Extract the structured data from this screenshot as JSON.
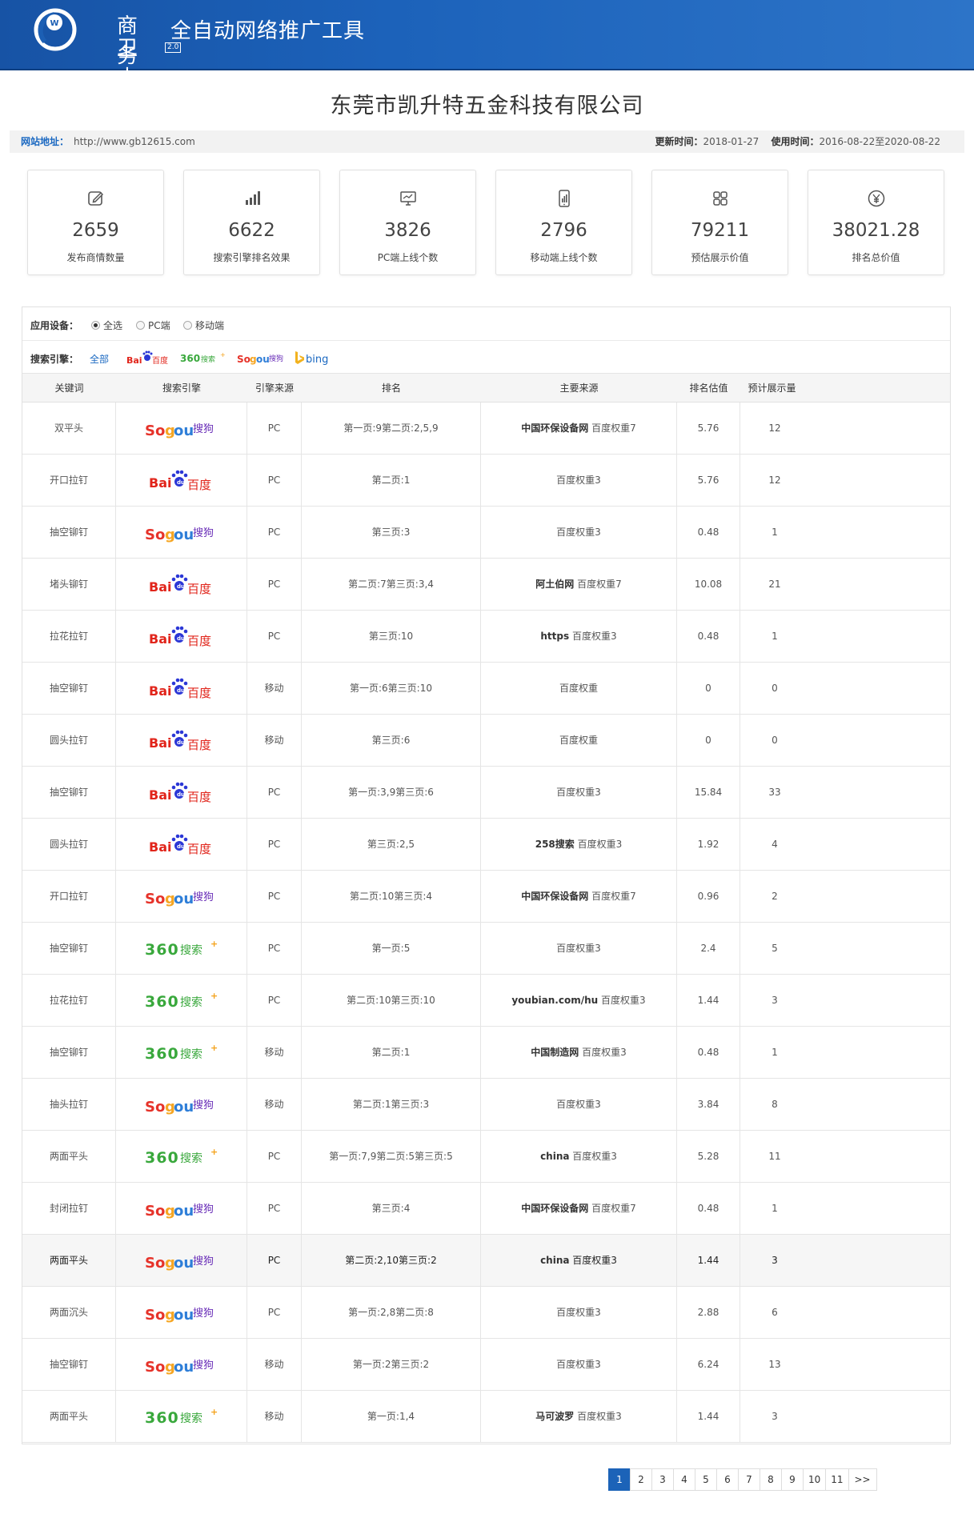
{
  "header": {
    "title": "全自动网络推广工具",
    "logo_line1": "商务",
    "logo_line2": "卫士",
    "logo_version": "2.0"
  },
  "company": "东莞市凯升特五金科技有限公司",
  "info": {
    "site_label": "网站地址：",
    "site_url": "http://www.gb12615.com",
    "update_label": "更新时间：",
    "update_value": "2018-01-27",
    "use_label": "使用时间：",
    "use_value": "2016-08-22至2020-08-22"
  },
  "stats": [
    {
      "icon": "edit-icon",
      "value": "2659",
      "label": "发布商情数量"
    },
    {
      "icon": "bar-chart-icon",
      "value": "6622",
      "label": "搜索引擎排名效果"
    },
    {
      "icon": "monitor-icon",
      "value": "3826",
      "label": "PC端上线个数"
    },
    {
      "icon": "mobile-icon",
      "value": "2796",
      "label": "移动端上线个数"
    },
    {
      "icon": "grid-icon",
      "value": "79211",
      "label": "预估展示价值"
    },
    {
      "icon": "yen-icon",
      "value": "38021.28",
      "label": "排名总价值"
    }
  ],
  "filters": {
    "device_label": "应用设备：",
    "device_options": [
      "全选",
      "PC端",
      "移动端"
    ],
    "device_selected": "全选",
    "engine_label": "搜索引擎：",
    "engine_all": "全部",
    "engines": [
      "baidu",
      "360",
      "sogou",
      "bing"
    ]
  },
  "columns": [
    "关键词",
    "搜索引擎",
    "引擎来源",
    "排名",
    "主要来源",
    "排名估值",
    "预计展示量"
  ],
  "rows": [
    {
      "keyword": "双平头",
      "engine": "sogou",
      "source": "PC",
      "rank": "第一页:9第二页:2,5,9",
      "main_b": "中国环保设备网",
      "main": " 百度权重7",
      "value": "5.76",
      "views": "12"
    },
    {
      "keyword": "开口拉钉",
      "engine": "baidu",
      "source": "PC",
      "rank": "第二页:1",
      "main_b": "",
      "main": "百度权重3",
      "value": "5.76",
      "views": "12"
    },
    {
      "keyword": "抽空铆钉",
      "engine": "sogou",
      "source": "PC",
      "rank": "第三页:3",
      "main_b": "",
      "main": "百度权重3",
      "value": "0.48",
      "views": "1"
    },
    {
      "keyword": "堵头铆钉",
      "engine": "baidu",
      "source": "PC",
      "rank": "第二页:7第三页:3,4",
      "main_b": "阿土伯网",
      "main": " 百度权重7",
      "value": "10.08",
      "views": "21"
    },
    {
      "keyword": "拉花拉钉",
      "engine": "baidu",
      "source": "PC",
      "rank": "第三页:10",
      "main_b": "https",
      "main": " 百度权重3",
      "value": "0.48",
      "views": "1"
    },
    {
      "keyword": "抽空铆钉",
      "engine": "baidu",
      "source": "移动",
      "rank": "第一页:6第三页:10",
      "main_b": "",
      "main": "百度权重",
      "value": "0",
      "views": "0"
    },
    {
      "keyword": "圆头拉钉",
      "engine": "baidu",
      "source": "移动",
      "rank": "第三页:6",
      "main_b": "",
      "main": "百度权重",
      "value": "0",
      "views": "0"
    },
    {
      "keyword": "抽空铆钉",
      "engine": "baidu",
      "source": "PC",
      "rank": "第一页:3,9第三页:6",
      "main_b": "",
      "main": "百度权重3",
      "value": "15.84",
      "views": "33"
    },
    {
      "keyword": "圆头拉钉",
      "engine": "baidu",
      "source": "PC",
      "rank": "第三页:2,5",
      "main_b": "258搜索",
      "main": " 百度权重3",
      "value": "1.92",
      "views": "4"
    },
    {
      "keyword": "开口拉钉",
      "engine": "sogou",
      "source": "PC",
      "rank": "第二页:10第三页:4",
      "main_b": "中国环保设备网",
      "main": " 百度权重7",
      "value": "0.96",
      "views": "2"
    },
    {
      "keyword": "抽空铆钉",
      "engine": "360",
      "source": "PC",
      "rank": "第一页:5",
      "main_b": "",
      "main": "百度权重3",
      "value": "2.4",
      "views": "5"
    },
    {
      "keyword": "拉花拉钉",
      "engine": "360",
      "source": "PC",
      "rank": "第二页:10第三页:10",
      "main_b": "youbian.com/hu",
      "main": " 百度权重3",
      "value": "1.44",
      "views": "3"
    },
    {
      "keyword": "抽空铆钉",
      "engine": "360",
      "source": "移动",
      "rank": "第二页:1",
      "main_b": "中国制造网",
      "main": " 百度权重3",
      "value": "0.48",
      "views": "1"
    },
    {
      "keyword": "抽头拉钉",
      "engine": "sogou",
      "source": "移动",
      "rank": "第二页:1第三页:3",
      "main_b": "",
      "main": "百度权重3",
      "value": "3.84",
      "views": "8"
    },
    {
      "keyword": "两面平头",
      "engine": "360",
      "source": "PC",
      "rank": "第一页:7,9第二页:5第三页:5",
      "main_b": "china",
      "main": " 百度权重3",
      "value": "5.28",
      "views": "11"
    },
    {
      "keyword": "封闭拉钉",
      "engine": "sogou",
      "source": "PC",
      "rank": "第三页:4",
      "main_b": "中国环保设备网",
      "main": " 百度权重7",
      "value": "0.48",
      "views": "1"
    },
    {
      "keyword": "两面平头",
      "engine": "sogou",
      "source": "PC",
      "rank": "第二页:2,10第三页:2",
      "main_b": "china",
      "main": " 百度权重3",
      "value": "1.44",
      "views": "3"
    },
    {
      "keyword": "两面沉头",
      "engine": "sogou",
      "source": "PC",
      "rank": "第一页:2,8第二页:8",
      "main_b": "",
      "main": "百度权重3",
      "value": "2.88",
      "views": "6"
    },
    {
      "keyword": "抽空铆钉",
      "engine": "sogou",
      "source": "移动",
      "rank": "第一页:2第三页:2",
      "main_b": "",
      "main": "百度权重3",
      "value": "6.24",
      "views": "13"
    },
    {
      "keyword": "两面平头",
      "engine": "360",
      "source": "移动",
      "rank": "第一页:1,4",
      "main_b": "马可波罗",
      "main": " 百度权重3",
      "value": "1.44",
      "views": "3"
    }
  ],
  "pagination": {
    "pages": [
      "1",
      "2",
      "3",
      "4",
      "5",
      "6",
      "7",
      "8",
      "9",
      "10",
      "11"
    ],
    "current": "1",
    "next": ">>"
  },
  "colors": {
    "brand": "#1c5fb4",
    "link": "#1a68c1",
    "pager_active": "#1c63b8"
  }
}
